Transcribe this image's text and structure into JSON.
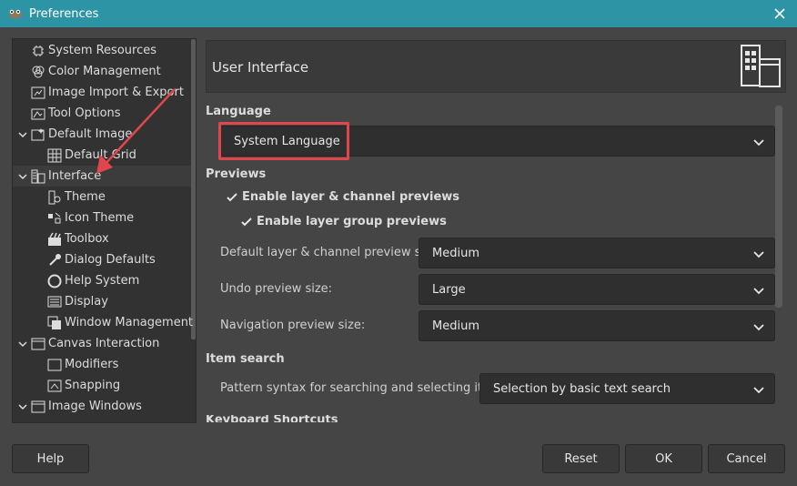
{
  "window": {
    "title": "Preferences"
  },
  "tree": {
    "items": [
      {
        "label": "System Resources",
        "icon": "chip-icon"
      },
      {
        "label": "Color Management",
        "icon": "color-circles-icon"
      },
      {
        "label": "Image Import & Export",
        "icon": "import-export-icon"
      },
      {
        "label": "Tool Options",
        "icon": "tool-options-icon"
      },
      {
        "label": "Default Image",
        "icon": "default-image-icon",
        "expanded": true
      },
      {
        "label": "Default Grid",
        "icon": "grid-icon"
      },
      {
        "label": "Interface",
        "icon": "interface-icon",
        "expanded": true,
        "selected": true
      },
      {
        "label": "Theme",
        "icon": "theme-icon"
      },
      {
        "label": "Icon Theme",
        "icon": "icon-theme-icon"
      },
      {
        "label": "Toolbox",
        "icon": "toolbox-icon"
      },
      {
        "label": "Dialog Defaults",
        "icon": "dialog-defaults-icon"
      },
      {
        "label": "Help System",
        "icon": "lifebuoy-icon"
      },
      {
        "label": "Display",
        "icon": "display-icon"
      },
      {
        "label": "Window Management",
        "icon": "window-management-icon"
      },
      {
        "label": "Canvas Interaction",
        "icon": "canvas-icon",
        "expanded": true
      },
      {
        "label": "Modifiers",
        "icon": "modifiers-icon"
      },
      {
        "label": "Snapping",
        "icon": "snapping-icon"
      },
      {
        "label": "Image Windows",
        "icon": "image-windows-icon",
        "expanded": true
      }
    ]
  },
  "page": {
    "title": "User Interface",
    "language": {
      "heading": "Language",
      "value": "System Language"
    },
    "previews": {
      "heading": "Previews",
      "enable_layer": "Enable layer & channel previews",
      "enable_group": "Enable layer group previews",
      "default_size_label": "Default layer & channel preview size:",
      "default_size_value": "Medium",
      "undo_label": "Undo preview size:",
      "undo_value": "Large",
      "nav_label": "Navigation preview size:",
      "nav_value": "Medium"
    },
    "item_search": {
      "heading": "Item search",
      "pattern_label": "Pattern syntax for searching and selecting items:",
      "pattern_value": "Selection by basic text search"
    },
    "keyboard_heading": "Keyboard Shortcuts"
  },
  "buttons": {
    "help": "Help",
    "reset": "Reset",
    "ok": "OK",
    "cancel": "Cancel"
  },
  "colors": {
    "titlebar": "#2c94a4",
    "annotation": "#e0474c"
  }
}
